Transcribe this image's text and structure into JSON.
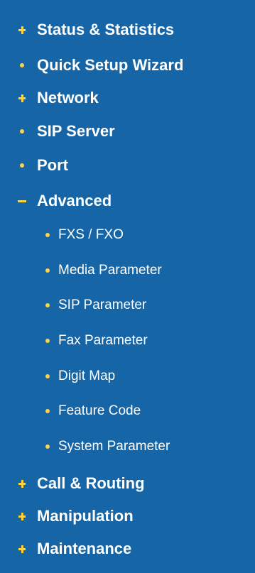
{
  "menu": {
    "items": [
      {
        "label": "Status & Statistics",
        "icon": "plus-icon"
      },
      {
        "label": "Quick Setup Wizard",
        "icon": "bullet-icon"
      },
      {
        "label": "Network",
        "icon": "plus-icon"
      },
      {
        "label": "SIP Server",
        "icon": "bullet-icon"
      },
      {
        "label": "Port",
        "icon": "bullet-icon"
      },
      {
        "label": "Advanced",
        "icon": "minus-icon"
      },
      {
        "label": "FXS / FXO",
        "icon": "bullet-icon"
      },
      {
        "label": "Media Parameter",
        "icon": "bullet-icon"
      },
      {
        "label": "SIP Parameter",
        "icon": "bullet-icon"
      },
      {
        "label": "Fax Parameter",
        "icon": "bullet-icon"
      },
      {
        "label": "Digit Map",
        "icon": "bullet-icon"
      },
      {
        "label": "Feature Code",
        "icon": "bullet-icon"
      },
      {
        "label": "System Parameter",
        "icon": "bullet-icon"
      },
      {
        "label": "Call & Routing",
        "icon": "plus-icon"
      },
      {
        "label": "Manipulation",
        "icon": "plus-icon"
      },
      {
        "label": "Maintenance",
        "icon": "plus-icon"
      }
    ]
  },
  "colors": {
    "background": "#1565a7",
    "text": "#ffffff",
    "marker": "#ffd23f"
  }
}
